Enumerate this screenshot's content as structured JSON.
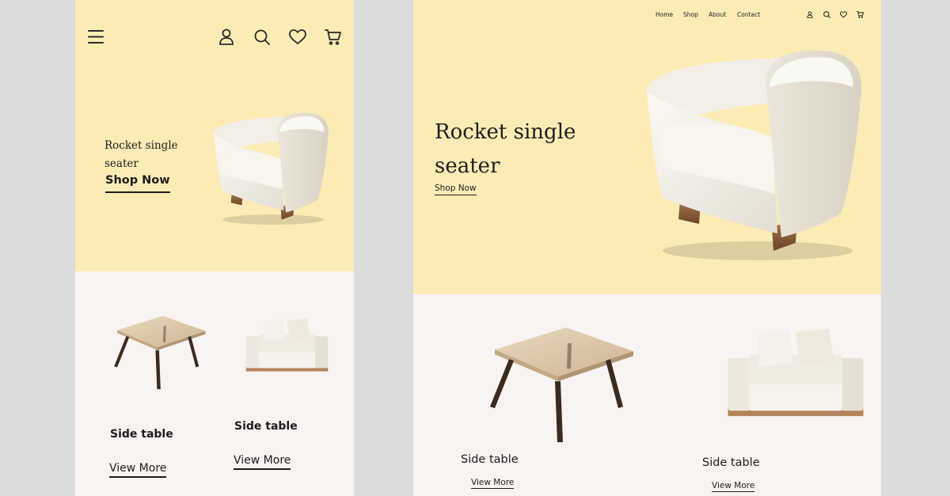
{
  "mobile": {
    "hero": {
      "title_line1": "Rocket single",
      "title_line2": "seater",
      "cta": "Shop Now"
    },
    "icons": [
      "menu-icon",
      "user-icon",
      "search-icon",
      "heart-icon",
      "cart-icon"
    ],
    "products": [
      {
        "name": "Side table",
        "link": "View More"
      },
      {
        "name": "Side table",
        "link": "View More"
      }
    ]
  },
  "desktop": {
    "nav": {
      "home": "Home",
      "shop": "Shop",
      "about": "About",
      "contact": "Contact"
    },
    "icons": [
      "user-icon",
      "search-icon",
      "heart-icon",
      "cart-icon"
    ],
    "hero": {
      "title_line1": "Rocket single",
      "title_line2": "seater",
      "cta": "Shop Now"
    },
    "products": [
      {
        "name": "Side table",
        "link": "View More"
      },
      {
        "name": "Side table",
        "link": "View More"
      }
    ]
  },
  "colors": {
    "hero_bg": "#fbecb5",
    "section_bg": "#f9f3f2",
    "page_bg": "#dcdcdc"
  }
}
